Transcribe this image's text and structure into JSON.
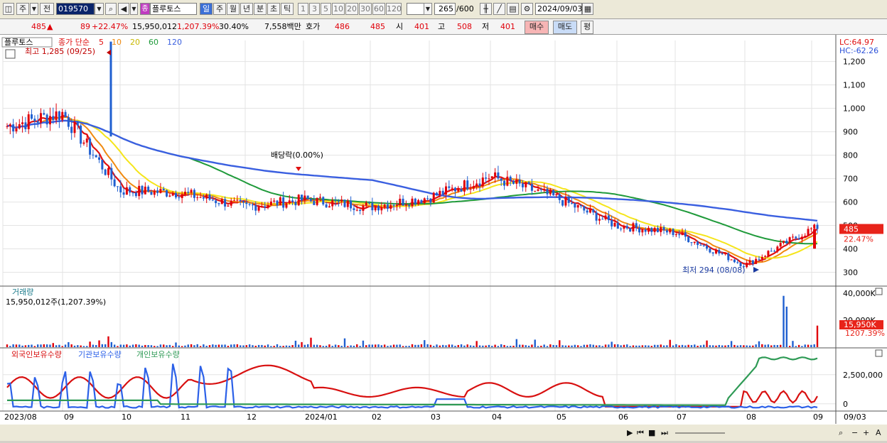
{
  "toolbar": {
    "market_label": "주",
    "jeon_label": "전",
    "stock_code": "019570",
    "stock_name": "플루토스",
    "stock_badge": "종",
    "periods": [
      "일",
      "주",
      "월",
      "년",
      "분",
      "초",
      "틱"
    ],
    "active_period": "일",
    "intervals": [
      "1",
      "3",
      "5",
      "10",
      "20",
      "30",
      "60",
      "120"
    ],
    "count_value": "265",
    "count_total": "/600",
    "date_value": "2024/09/03"
  },
  "quote": {
    "price": "485",
    "change_arrow": "▲",
    "change": "89",
    "change_pct": "+22.47%",
    "volume": "15,950,012",
    "volume_pct": "1,207.39%",
    "turnover": "30.40%",
    "amount": "7,558백만",
    "hoga_label": "호가",
    "hoga_ask": "486",
    "hoga_bid": "485",
    "open_label": "시",
    "open": "401",
    "high_label": "고",
    "high": "508",
    "low_label": "저",
    "low": "401",
    "buy_label": "매수",
    "sell_label": "매도",
    "avg_label": "평"
  },
  "price_pane": {
    "legend_name": "플루토스",
    "legend_ma_label": "종가 단순",
    "ma_periods": [
      "5",
      "10",
      "20",
      "60",
      "120"
    ],
    "lc_label": "LC:64.97",
    "hc_label": "HC:-62.26",
    "high_annotation": "최고 1,285 (09/25)",
    "low_annotation": "최저 294 (08/08)",
    "dividend_annotation": "배당락(0.00%)",
    "current_price_tag": "485",
    "current_pct_tag": "22.47%",
    "y_axis": [
      {
        "label": "1,200",
        "v": 1200
      },
      {
        "label": "1,100",
        "v": 1100
      },
      {
        "label": "1,000",
        "v": 1000
      },
      {
        "label": "900",
        "v": 900
      },
      {
        "label": "800",
        "v": 800
      },
      {
        "label": "700",
        "v": 700
      },
      {
        "label": "600",
        "v": 600
      },
      {
        "label": "500",
        "v": 500
      },
      {
        "label": "400",
        "v": 400
      },
      {
        "label": "300",
        "v": 300
      }
    ]
  },
  "volume_pane": {
    "title": "거래량",
    "info": "15,950,012주(1,207.39%)",
    "y_axis": [
      {
        "label": "40,000K",
        "v": 40000
      },
      {
        "label": "20,000K",
        "v": 20000
      }
    ],
    "tag": "15,950K",
    "tag_pct": "1207.39%"
  },
  "holdings_pane": {
    "legend": [
      "외국인보유수량",
      "기관보유수량",
      "개인보유수량"
    ],
    "y_axis": [
      {
        "label": "2,500,000",
        "v": 2500000
      },
      {
        "label": "0",
        "v": 0
      }
    ]
  },
  "x_axis": {
    "labels": [
      "2023/08",
      "09",
      "10",
      "11",
      "12",
      "2024/01",
      "02",
      "03",
      "04",
      "05",
      "06",
      "07",
      "08",
      "09"
    ],
    "right_label": "09/03"
  },
  "colors": {
    "up": "#e0000a",
    "down": "#1f5fd0",
    "ma5": "#e01010",
    "ma10": "#f08a10",
    "ma20": "#f5e51a",
    "ma60": "#1f9a3a",
    "ma120": "#3a5fe0",
    "foreign": "#d81010",
    "institution": "#2b60e8",
    "individual": "#2e9a55"
  },
  "chart_data": {
    "type": "candlestick",
    "xlabel": "",
    "ylabel": "",
    "months": [
      "2023/08",
      "09",
      "10",
      "11",
      "12",
      "2024/01",
      "02",
      "03",
      "04",
      "05",
      "06",
      "07",
      "08",
      "09"
    ],
    "price_ylim": [
      250,
      1290
    ],
    "price_high": {
      "value": 1285,
      "date": "09/25"
    },
    "price_low": {
      "value": 294,
      "date": "08/08"
    },
    "close_series": [
      {
        "name": "종가",
        "x": [
          "2023/08",
          "2023/09",
          "2023/10",
          "2023/11",
          "2023/12",
          "2024/01",
          "2024/02",
          "2024/03",
          "2024/04",
          "2024/05",
          "2024/06",
          "2024/07",
          "2024/08",
          "2024/09/03"
        ],
        "y": [
          920,
          980,
          650,
          640,
          580,
          610,
          580,
          620,
          710,
          620,
          500,
          470,
          330,
          485
        ]
      }
    ],
    "volume_k": {
      "peak": 40000,
      "last": 15950
    },
    "holdings_ylim": [
      -500000,
      4500000
    ]
  }
}
